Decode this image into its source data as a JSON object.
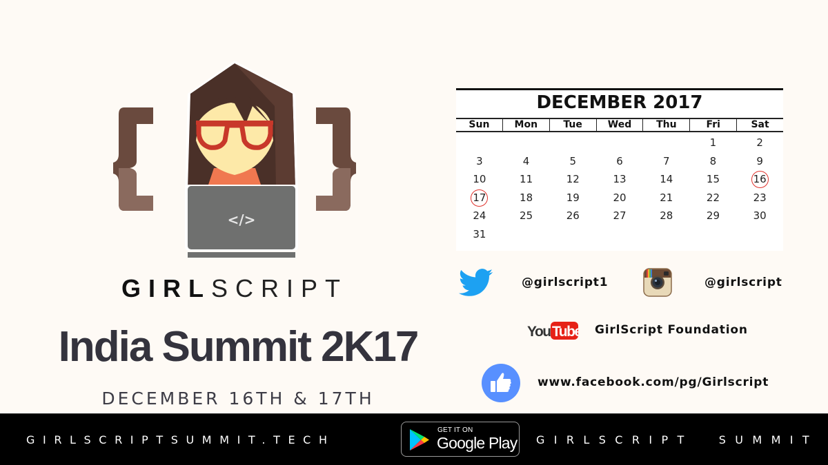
{
  "logo": {
    "icon": "girl-coder-with-laptop-icon",
    "laptop_glyph": "</>",
    "colors": {
      "hair": "#4a3028",
      "brace": "#6a4a3e",
      "skin": "#fde9a8",
      "glasses": "#c8382a",
      "shirt": "#f07850",
      "laptop": "#6f706f"
    }
  },
  "brand": {
    "bold": "GIRL",
    "light": "SCRIPT"
  },
  "event": {
    "title": "India Summit 2K17",
    "dates": "DECEMBER 16TH & 17TH"
  },
  "calendar": {
    "title": "DECEMBER 2017",
    "weekdays": [
      "Sun",
      "Mon",
      "Tue",
      "Wed",
      "Thu",
      "Fri",
      "Sat"
    ],
    "weeks": [
      [
        "",
        "",
        "",
        "",
        "",
        "1",
        "2"
      ],
      [
        "3",
        "4",
        "5",
        "6",
        "7",
        "8",
        "9"
      ],
      [
        "10",
        "11",
        "12",
        "13",
        "14",
        "15",
        "16"
      ],
      [
        "17",
        "18",
        "19",
        "20",
        "21",
        "22",
        "23"
      ],
      [
        "24",
        "25",
        "26",
        "27",
        "28",
        "29",
        "30"
      ],
      [
        "31",
        "",
        "",
        "",
        "",
        "",
        ""
      ]
    ],
    "marked_days": [
      "16",
      "17"
    ],
    "mark_color": "#e0322c"
  },
  "social": {
    "twitter": {
      "icon": "twitter-bird-icon",
      "handle": "@girlscript1",
      "color": "#1da1f2"
    },
    "instagram": {
      "icon": "instagram-camera-icon",
      "handle": "@girlscript"
    },
    "youtube": {
      "icon": "youtube-logo-icon",
      "logo_you": "You",
      "logo_tube": "Tube",
      "channel": "GirlScript Foundation",
      "color": "#e62117"
    },
    "facebook": {
      "icon": "thumbs-up-icon",
      "url": "www.facebook.com/pg/Girlscript",
      "color": "#5890ff"
    }
  },
  "footer": {
    "website": "GIRLSCRIPTSUMMIT.TECH",
    "app_badge": {
      "small": "GET IT ON",
      "big": "Google Play",
      "icon": "google-play-icon"
    },
    "tagline": "GIRLSCRIPT  SUMMIT"
  }
}
